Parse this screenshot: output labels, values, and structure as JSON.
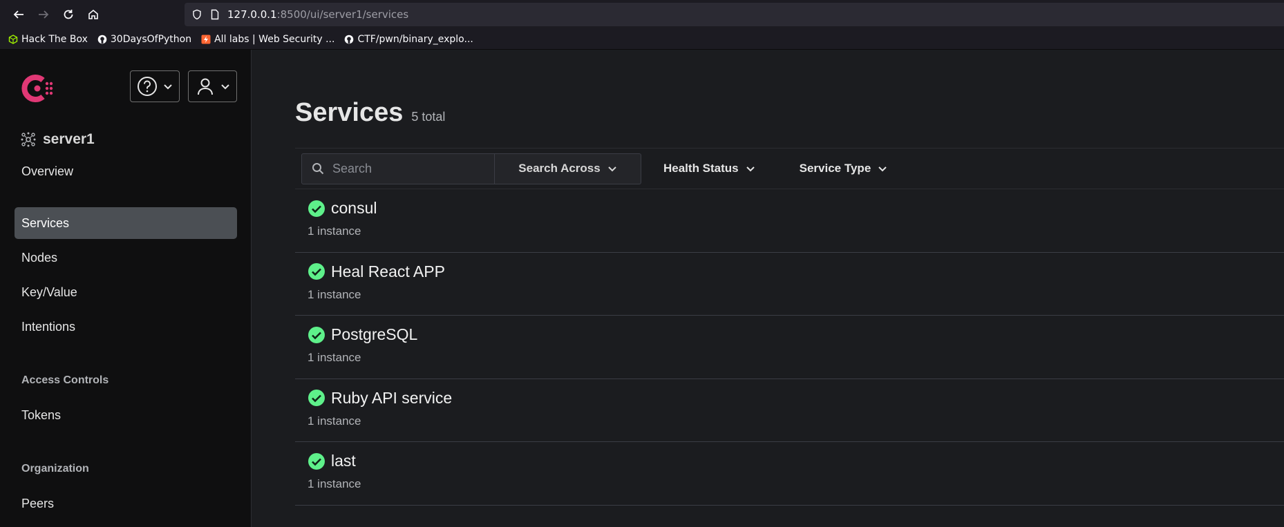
{
  "browser": {
    "url_host": "127.0.0.1",
    "url_rest": ":8500/ui/server1/services",
    "bookmarks": [
      {
        "label": "Hack The Box",
        "icon": "cube-icon"
      },
      {
        "label": "30DaysOfPython",
        "icon": "github-icon"
      },
      {
        "label": "All labs | Web Security ...",
        "icon": "portswigger-icon"
      },
      {
        "label": "CTF/pwn/binary_explo...",
        "icon": "github-icon"
      }
    ]
  },
  "sidebar": {
    "datacenter": "server1",
    "items": [
      {
        "label": "Overview",
        "active": false
      },
      {
        "label": "Services",
        "active": true
      },
      {
        "label": "Nodes",
        "active": false
      },
      {
        "label": "Key/Value",
        "active": false
      },
      {
        "label": "Intentions",
        "active": false
      }
    ],
    "access_controls_heading": "Access Controls",
    "access_items": [
      {
        "label": "Tokens"
      }
    ],
    "organization_heading": "Organization",
    "organization_items": [
      {
        "label": "Peers"
      }
    ]
  },
  "main": {
    "title": "Services",
    "total": "5 total",
    "search_placeholder": "Search",
    "search_across": "Search Across",
    "health_status": "Health Status",
    "service_type": "Service Type",
    "services": [
      {
        "name": "consul",
        "instances": "1 instance"
      },
      {
        "name": "Heal React APP",
        "instances": "1 instance"
      },
      {
        "name": "PostgreSQL",
        "instances": "1 instance"
      },
      {
        "name": "Ruby API service",
        "instances": "1 instance"
      },
      {
        "name": "last",
        "instances": "1 instance"
      }
    ]
  },
  "colors": {
    "brand": "#e03875",
    "passing": "#5ef08a",
    "sidebar_bg": "#0f0f10",
    "main_bg": "#1b1c1f"
  }
}
